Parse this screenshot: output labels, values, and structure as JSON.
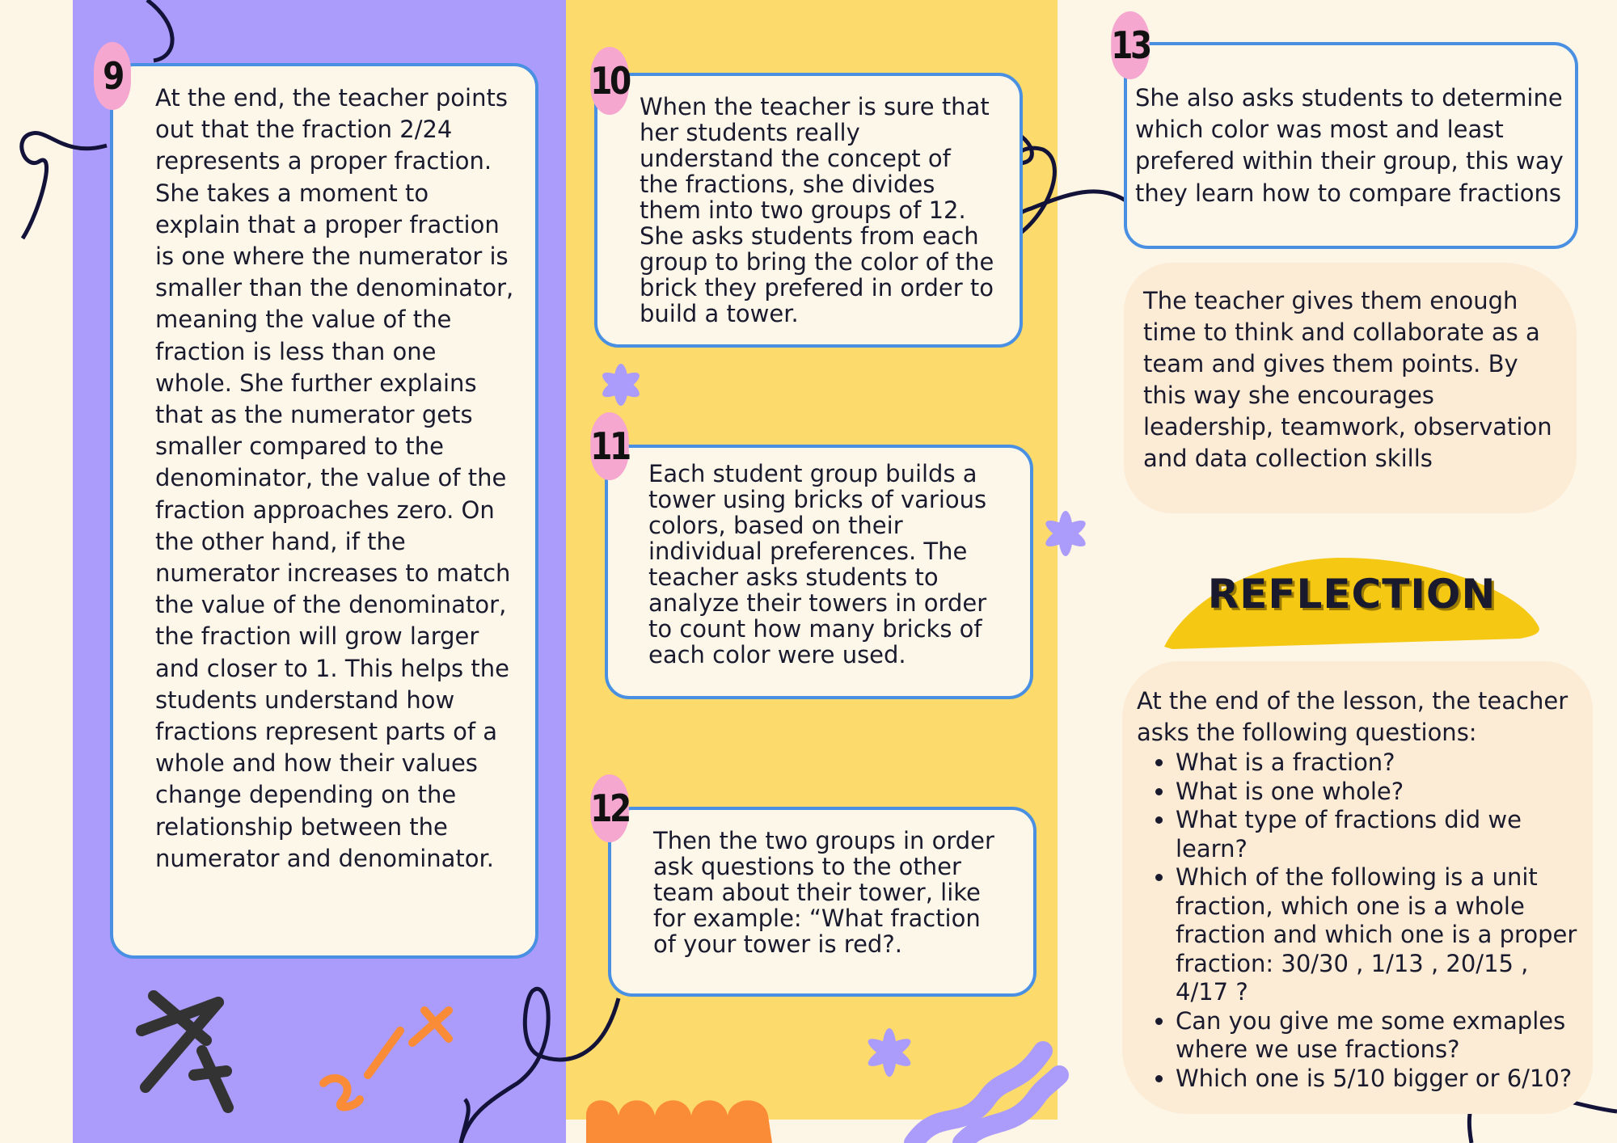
{
  "steps": [
    {
      "number": "9",
      "text": "At the end, the teacher points out that the fraction 2/24 represents a proper fraction. She takes a moment to explain that a proper fraction is one where the numerator is smaller than the denominator, meaning the value of the fraction is less than one whole. She further explains that as the numerator gets smaller compared to the denominator, the value of the fraction approaches zero. On the other hand, if the numerator increases to match the value of the denominator, the fraction will grow larger and closer to 1. This helps the students understand how fractions represent parts of a whole and how their values change depending on the relationship between the numerator and denominator."
    },
    {
      "number": "10",
      "text": "When the teacher is sure that her students really understand the concept of the fractions, she divides them into two groups of 12. She asks students from each group to bring the color of the brick they prefered in order to build a tower."
    },
    {
      "number": "11",
      "text": "Each student group builds a tower using bricks of various colors, based on their individual preferences. The teacher asks students to analyze their towers in order to count how many bricks of each color were used."
    },
    {
      "number": "12",
      "text": "Then the two groups in order ask questions to the other team about their tower, like for example: “What fraction of your tower is red?."
    },
    {
      "number": "13",
      "text": "She also asks students to determine which color was most and least prefered within their group, this way they learn how to compare fractions"
    }
  ],
  "teamwork_note": "The teacher gives them enough time to think and collaborate as a team and gives them points. By this way she encourages leadership, teamwork, observation and data collection skills",
  "reflection": {
    "title": "REFLECTION",
    "intro": "At the end of the lesson, the teacher asks the following questions:",
    "questions": [
      "What is a fraction?",
      "What is one whole?",
      "What type of fractions did we learn?",
      "Which of the following is a unit fraction, which one is a whole fraction and which one is a proper fraction: 30/30 , 1/13 , 20/15 , 4/17 ?",
      "Can you give me some exmaples where we use fractions?",
      "Which one is 5/10 bigger  or 6/10?"
    ]
  },
  "decorations": {
    "fraction_one": "x/y",
    "fraction_two": "1/2",
    "colors": {
      "purple": "#ab9bfb",
      "yellow": "#fcdb6c",
      "cream": "#fdf5e6",
      "card_border": "#4a90e2",
      "badge": "#f6a7cf",
      "reflection": "#f5c814",
      "orange": "#fb8c37"
    }
  }
}
